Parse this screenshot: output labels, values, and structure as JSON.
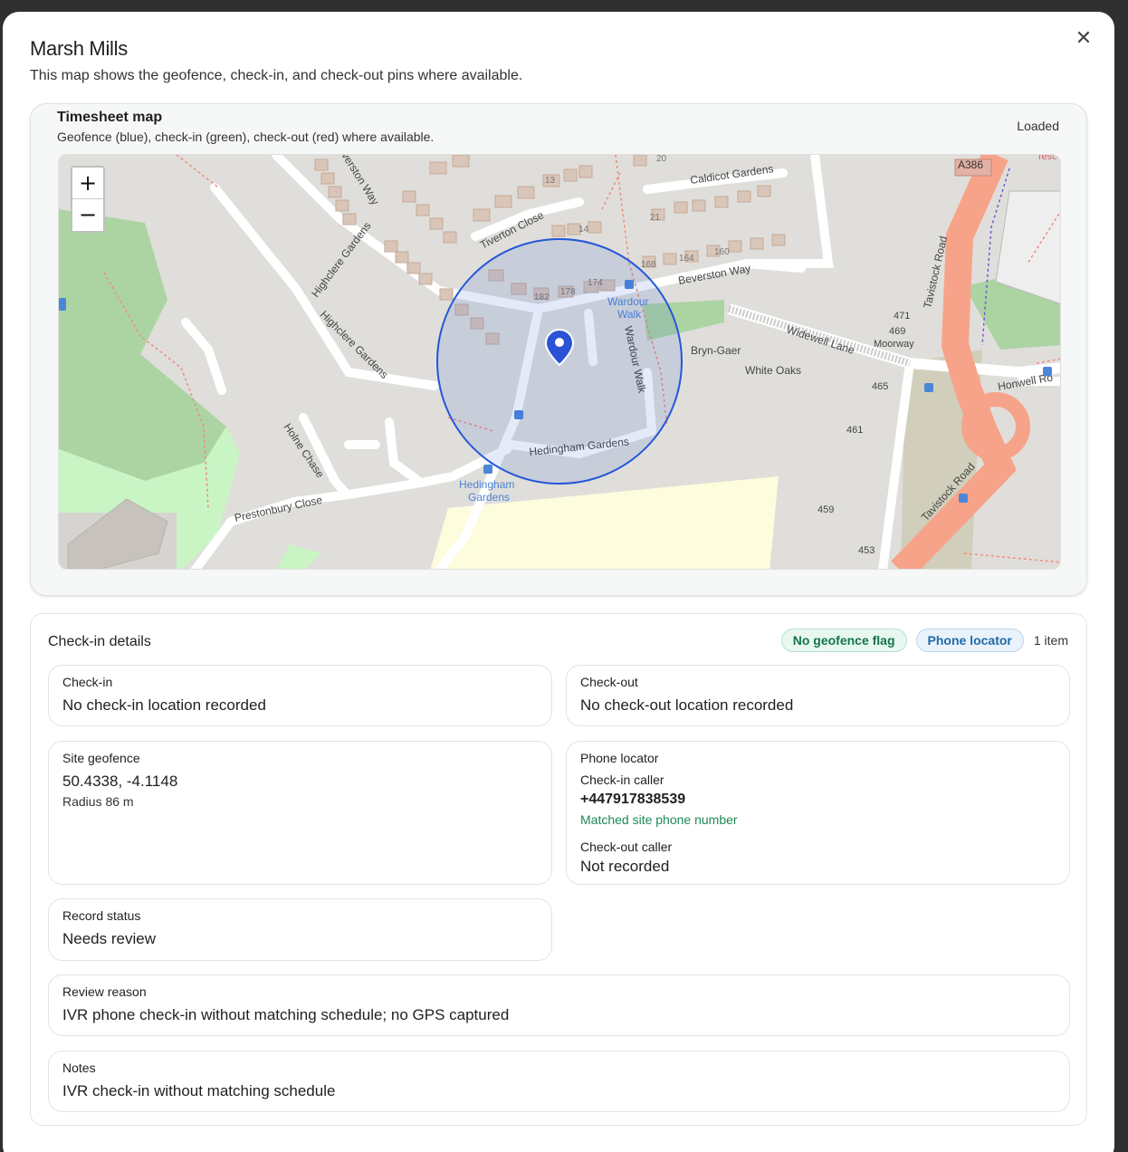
{
  "modal": {
    "title": "Marsh Mills",
    "subtitle": "This map shows the geofence, check-in, and check-out pins where available.",
    "close_icon": "close-icon"
  },
  "map": {
    "title": "Timesheet map",
    "subtitle": "Geofence (blue), check-in (green), check-out (red) where available.",
    "status": "Loaded",
    "zoom_in": "+",
    "zoom_out": "−",
    "labels": {
      "a386": "A386",
      "tesco": "Tesc",
      "caldicot": "Caldicot Gardens",
      "tiverton": "Tiverton Close",
      "beverston_way_top": "verston Way",
      "beverston_way": "Beverston Way",
      "highclere_1": "Highclere Gardens",
      "highclere_2": "Highclere Gardens",
      "holne": "Holne Chase",
      "prestonbury": "Prestonbury Close",
      "hedingham": "Hedingham Gardens",
      "hedingham_stop_1": "Hedingham",
      "hedingham_stop_2": "Gardens",
      "wardour_stop_1": "Wardour",
      "wardour_stop_2": "Walk",
      "wardour_walk": "Wardour Walk",
      "widewell": "Widewell Lane",
      "tavistock_1": "Tavistock Road",
      "tavistock_2": "Tavistock Road",
      "honwell": "Honwell Ro",
      "bryn_gaer": "Bryn-Gaer",
      "white_oaks": "White Oaks",
      "moorway": "Moorway",
      "n471": "471",
      "n469": "469",
      "n465": "465",
      "n461": "461",
      "n459": "459",
      "n453": "453",
      "n13": "13",
      "n14": "14",
      "n20": "20",
      "n21": "21",
      "n168": "168",
      "n164": "164",
      "n160": "160",
      "n182": "182",
      "n178": "178",
      "n174": "174"
    },
    "colors": {
      "geofence": "#2456d8",
      "pin": "#2a52d6"
    }
  },
  "details": {
    "title": "Check-in details",
    "badges": {
      "geofence": "No geofence flag",
      "phone": "Phone locator"
    },
    "count": "1 item",
    "checkin": {
      "label": "Check-in",
      "value": "No check-in location recorded"
    },
    "checkout": {
      "label": "Check-out",
      "value": "No check-out location recorded"
    },
    "geofence": {
      "label": "Site geofence",
      "coords": "50.4338, -4.1148",
      "radius": "Radius 86 m"
    },
    "phone": {
      "label": "Phone locator",
      "checkin_caller_label": "Check-in caller",
      "checkin_caller": "+447917838539",
      "checkin_match": "Matched site phone number",
      "checkout_caller_label": "Check-out caller",
      "checkout_caller": "Not recorded"
    },
    "record": {
      "label": "Record status",
      "value": "Needs review"
    },
    "review": {
      "label": "Review reason",
      "value": "IVR phone check-in without matching schedule; no GPS captured"
    },
    "notes": {
      "label": "Notes",
      "value": "IVR check-in without matching schedule"
    }
  }
}
